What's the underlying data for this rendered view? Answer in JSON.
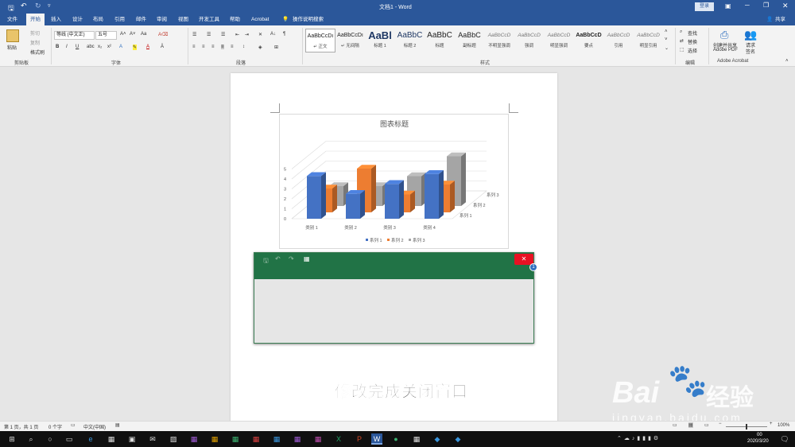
{
  "titlebar": {
    "doc_title": "文档1 - Word",
    "login": "登录"
  },
  "tabs": [
    "文件",
    "开始",
    "插入",
    "设计",
    "布局",
    "引用",
    "邮件",
    "审阅",
    "视图",
    "开发工具",
    "帮助",
    "Acrobat"
  ],
  "tell_me": "操作说明搜索",
  "share": "共享",
  "ribbon": {
    "clipboard": {
      "paste": "粘贴",
      "cut": "剪切",
      "copy": "复制",
      "format_painter": "格式刷",
      "group": "剪贴板"
    },
    "font": {
      "name": "等线 (中文正)",
      "size": "五号",
      "aa": "Aa",
      "group": "字体"
    },
    "paragraph": {
      "group": "段落"
    },
    "styles": {
      "group": "样式",
      "items": [
        {
          "preview": "AaBbCcDı",
          "label": "↵ 正文"
        },
        {
          "preview": "AaBbCcDı",
          "label": "↵ 无间隔"
        },
        {
          "preview": "AaBl",
          "label": "标题 1"
        },
        {
          "preview": "AaBbC",
          "label": "标题 2"
        },
        {
          "preview": "AaBbC",
          "label": "标题"
        },
        {
          "preview": "AaBbC",
          "label": "副标题"
        },
        {
          "preview": "AaBbCcD",
          "label": "不明显强调"
        },
        {
          "preview": "AaBbCcD",
          "label": "强调"
        },
        {
          "preview": "AaBbCcD",
          "label": "明显强调"
        },
        {
          "preview": "AaBbCcD",
          "label": "要点"
        },
        {
          "preview": "AaBbCcD",
          "label": "引用"
        },
        {
          "preview": "AaBbCcD",
          "label": "明显引用"
        }
      ]
    },
    "editing": {
      "find": "查找",
      "replace": "替换",
      "select": "选择",
      "group": "编辑"
    },
    "acrobat": {
      "create_share": "创建并共享",
      "adobe_pdf": "Adobe PDF",
      "request": "请求",
      "sign": "签名",
      "group": "Adobe Acrobat"
    }
  },
  "chart_data": {
    "type": "bar",
    "title": "图表标题",
    "categories": [
      "类别 1",
      "类别 2",
      "类别 3",
      "类别 4"
    ],
    "series": [
      {
        "name": "系列 1",
        "values": [
          4.3,
          2.5,
          3.5,
          4.5
        ]
      },
      {
        "name": "系列 2",
        "values": [
          2.4,
          4.4,
          1.8,
          2.8
        ]
      },
      {
        "name": "系列 3",
        "values": [
          2.0,
          2.0,
          3.0,
          5.0
        ]
      }
    ],
    "ylim": [
      0,
      5
    ],
    "yticks": [
      "0",
      "1",
      "2",
      "3",
      "4",
      "5"
    ],
    "legend": "bottom",
    "colors": [
      "#4472c4",
      "#ed7d31",
      "#a5a5a5"
    ]
  },
  "caption": "修改完成关闭窗口",
  "watermark": {
    "brand": "Bai",
    "brand2": "经验",
    "url": "jingyan.baidu.com"
  },
  "status": {
    "page": "第 1 页，共 1 页",
    "words": "0 个字",
    "lang": "中文(中国)",
    "zoom": "100%"
  },
  "taskbar": {
    "time": "00",
    "date": "2020/3/20"
  }
}
